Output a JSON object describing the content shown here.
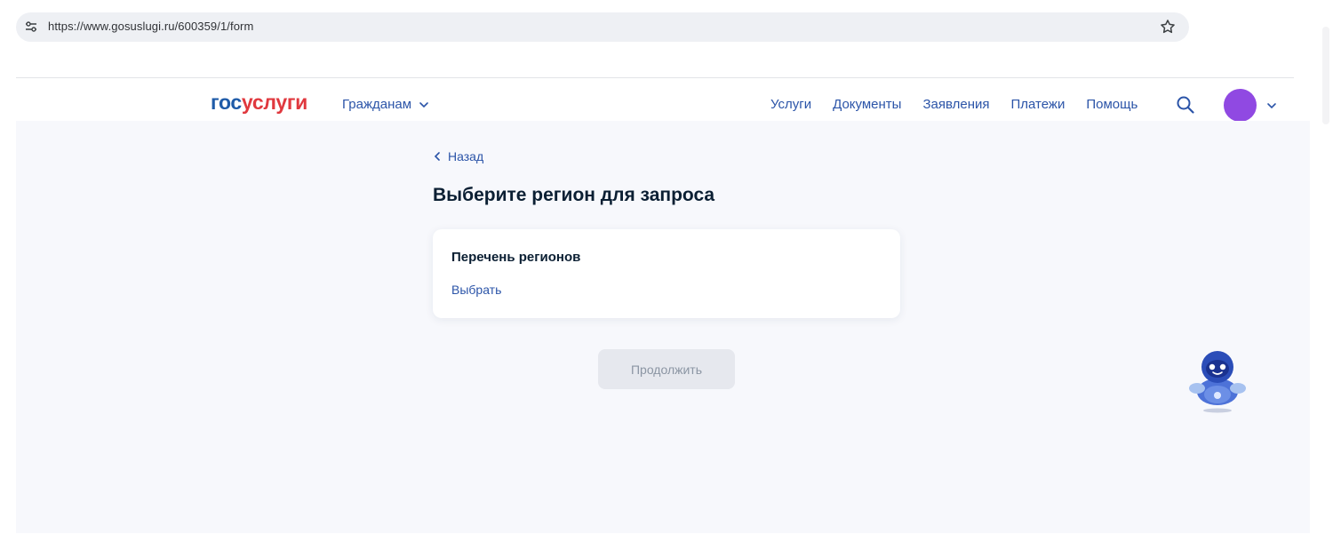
{
  "browser": {
    "url": "https://www.gosuslugi.ru/600359/1/form",
    "site_info_icon": "tune-icon",
    "bookmark_icon": "star-icon"
  },
  "header": {
    "logo_part1": "гос",
    "logo_part2": "услуги",
    "audience_menu": "Гражданам",
    "nav": [
      "Услуги",
      "Документы",
      "Заявления",
      "Платежи",
      "Помощь"
    ],
    "search_icon": "search-icon",
    "avatar_color": "#9049e2"
  },
  "main": {
    "back_label": "Назад",
    "title": "Выберите регион для запроса",
    "card": {
      "title": "Перечень регионов",
      "link": "Выбрать"
    },
    "continue_label": "Продолжить",
    "assistant_icon": "robot-assistant-icon"
  },
  "colors": {
    "accent": "#2b54a8",
    "logo_blue": "#1f5ba8",
    "logo_red": "#e0383e",
    "page_bg": "#f7f8fc",
    "disabled_button": "#e6e8ee"
  }
}
